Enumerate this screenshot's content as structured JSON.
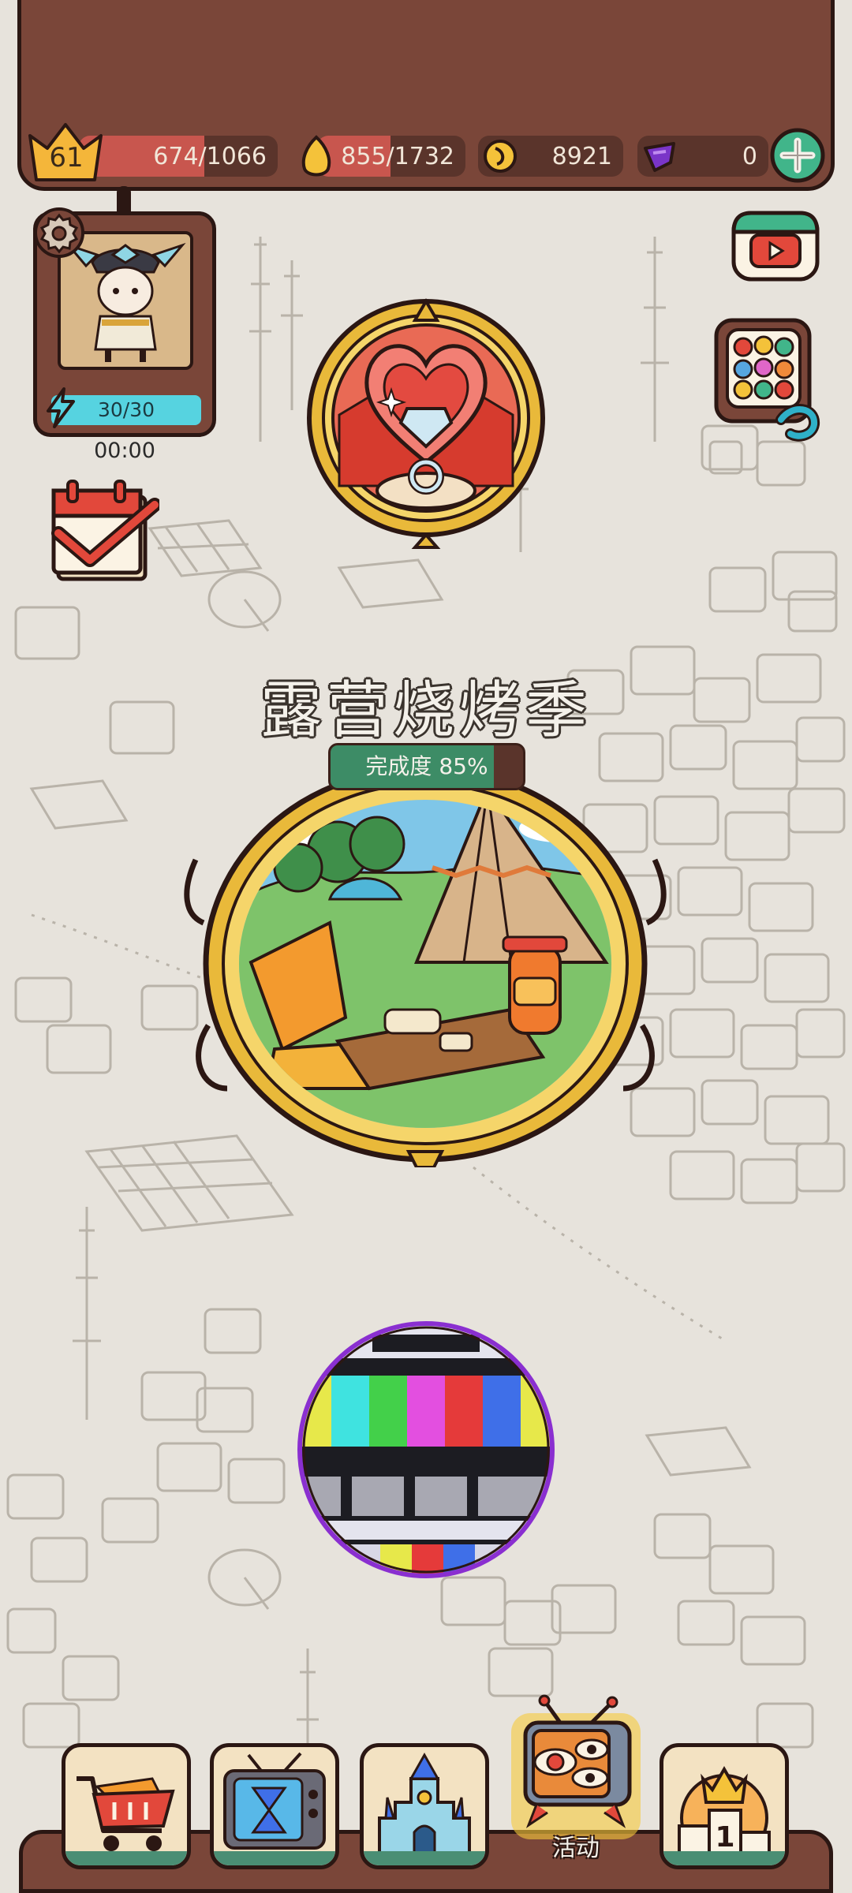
{
  "hud": {
    "level": "61",
    "exp_text": "674/1066",
    "exp_fraction": 0.632,
    "seed_text": "855/1732",
    "seed_fraction": 0.494,
    "coin_text": "8921",
    "gem_text": "0"
  },
  "avatar": {
    "energy_text": "30/30",
    "energy_fraction": 1.0,
    "timer": "00:00"
  },
  "event": {
    "title": "露营烧烤季",
    "progress_text": "完成度 85%",
    "progress_fraction": 0.85
  },
  "nav": {
    "items": [
      {
        "icon": "shop-cart-icon"
      },
      {
        "icon": "hourglass-tv-icon"
      },
      {
        "icon": "castle-icon"
      },
      {
        "icon": "eye-tv-icon",
        "label": "活动",
        "selected": true
      },
      {
        "icon": "ranking-podium-icon"
      }
    ]
  },
  "colors": {
    "panel": "#7a4639",
    "outline": "#2b1713",
    "accent_green": "#3d8c66",
    "exp_red": "#c8564e",
    "energy_cyan": "#56d3e0",
    "background": "#e7e3dc"
  }
}
